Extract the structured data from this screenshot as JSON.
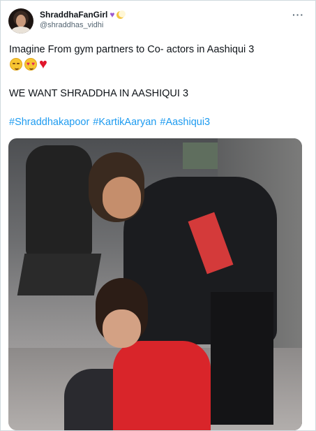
{
  "tweet": {
    "display_name": "ShraddhaFanGirl",
    "handle": "@shraddhas_vidhi",
    "line1": "Imagine From gym partners to Co- actors in Aashiqui 3",
    "line2": "WE WANT SHRADDHA IN AASHIQUI 3",
    "hashtags": [
      "#Shraddhakapoor",
      "#KartikAaryan",
      "#Aashiqui3"
    ],
    "more_label": "···",
    "name_icons": [
      "purple-heart-icon",
      "crescent-moon-icon"
    ],
    "emojis": [
      "pleading-face-icon",
      "heart-eyes-face-icon",
      "red-heart-icon"
    ]
  },
  "colors": {
    "link": "#1d9bf0",
    "muted": "#536471",
    "text": "#0f1419"
  }
}
